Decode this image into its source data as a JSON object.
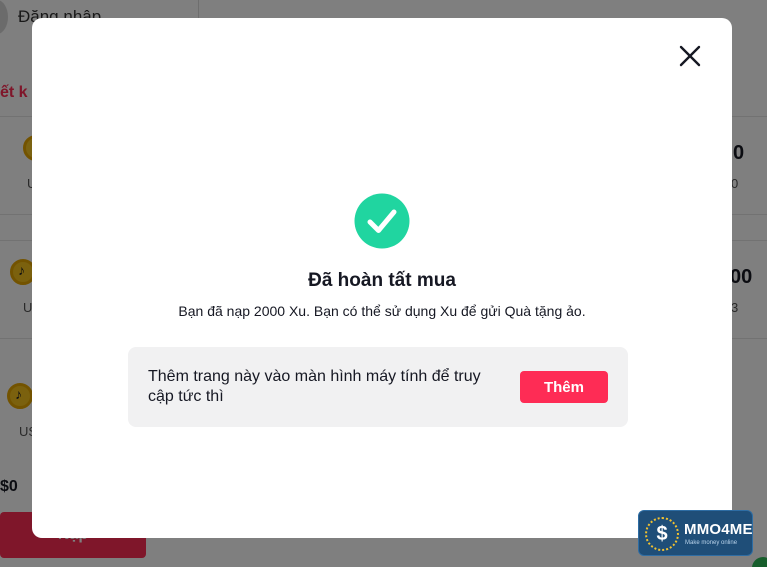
{
  "background": {
    "login_text": "Đăng nhập",
    "section_link": "ết k",
    "rows": [
      {
        "label": "U",
        "amount": "0",
        "sub": "0"
      },
      {
        "label": "U",
        "amount": "00",
        "sub": "3"
      },
      {
        "label": "US",
        "amount": "",
        "sub": ""
      }
    ],
    "dollar_text": "$0",
    "recharge_button": "Nạp"
  },
  "modal": {
    "close_icon": "close-icon",
    "success_icon": "check-circle-icon",
    "success_color": "#20d5a0",
    "title": "Đã hoàn tất mua",
    "description": "Bạn đã nạp 2000 Xu. Bạn có thể sử dụng Xu để gửi Quà tặng ảo.",
    "shortcut": {
      "text": "Thêm trang này vào màn hình máy tính để truy cập tức thì",
      "button_label": "Thêm",
      "button_color": "#fe2c55"
    }
  },
  "watermark": {
    "title": "MMO4ME",
    "subtitle": "Make money online"
  }
}
